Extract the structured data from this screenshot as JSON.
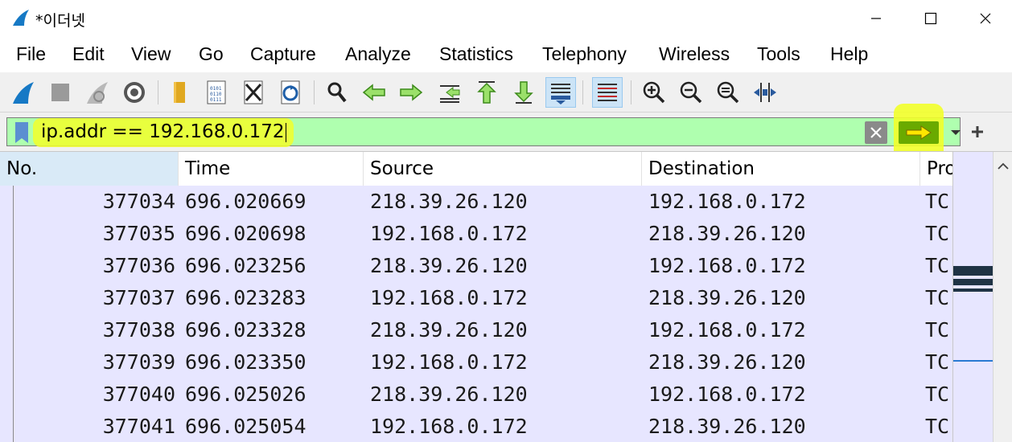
{
  "window": {
    "title": "*이더넷",
    "controls": {
      "minimize": "minimize",
      "maximize": "maximize",
      "close": "close"
    }
  },
  "menu": {
    "items": [
      "File",
      "Edit",
      "View",
      "Go",
      "Capture",
      "Analyze",
      "Statistics",
      "Telephony",
      "Wireless",
      "Tools",
      "Help"
    ]
  },
  "toolbar": {
    "buttons": [
      "start-capture-icon",
      "stop-capture-icon",
      "restart-capture-icon",
      "capture-options-icon",
      "open-file-icon",
      "save-file-icon",
      "close-file-icon",
      "reload-file-icon",
      "find-packet-icon",
      "go-back-icon",
      "go-forward-icon",
      "go-to-packet-icon",
      "go-first-packet-icon",
      "go-last-packet-icon",
      "auto-scroll-icon",
      "colorize-icon",
      "zoom-in-icon",
      "zoom-out-icon",
      "zoom-normal-icon",
      "resize-columns-icon"
    ]
  },
  "filter": {
    "value": "ip.addr == 192.168.0.172",
    "background": "#afffaf",
    "highlight_color": "#f2ff2a"
  },
  "packet_list": {
    "columns": [
      "No.",
      "Time",
      "Source",
      "Destination",
      "Protocol"
    ],
    "column_labels_visible": [
      "No.",
      "Time",
      "Source",
      "Destination",
      "Pro"
    ],
    "row_color": "#e7e6ff",
    "rows": [
      {
        "no": "377034",
        "time": "696.020669",
        "source": "218.39.26.120",
        "destination": "192.168.0.172",
        "protocol": "TC"
      },
      {
        "no": "377035",
        "time": "696.020698",
        "source": "192.168.0.172",
        "destination": "218.39.26.120",
        "protocol": "TC"
      },
      {
        "no": "377036",
        "time": "696.023256",
        "source": "218.39.26.120",
        "destination": "192.168.0.172",
        "protocol": "TC"
      },
      {
        "no": "377037",
        "time": "696.023283",
        "source": "192.168.0.172",
        "destination": "218.39.26.120",
        "protocol": "TC"
      },
      {
        "no": "377038",
        "time": "696.023328",
        "source": "218.39.26.120",
        "destination": "192.168.0.172",
        "protocol": "TC"
      },
      {
        "no": "377039",
        "time": "696.023350",
        "source": "192.168.0.172",
        "destination": "218.39.26.120",
        "protocol": "TC"
      },
      {
        "no": "377040",
        "time": "696.025026",
        "source": "218.39.26.120",
        "destination": "192.168.0.172",
        "protocol": "TC"
      },
      {
        "no": "377041",
        "time": "696.025054",
        "source": "192.168.0.172",
        "destination": "218.39.26.120",
        "protocol": "TC"
      }
    ]
  }
}
